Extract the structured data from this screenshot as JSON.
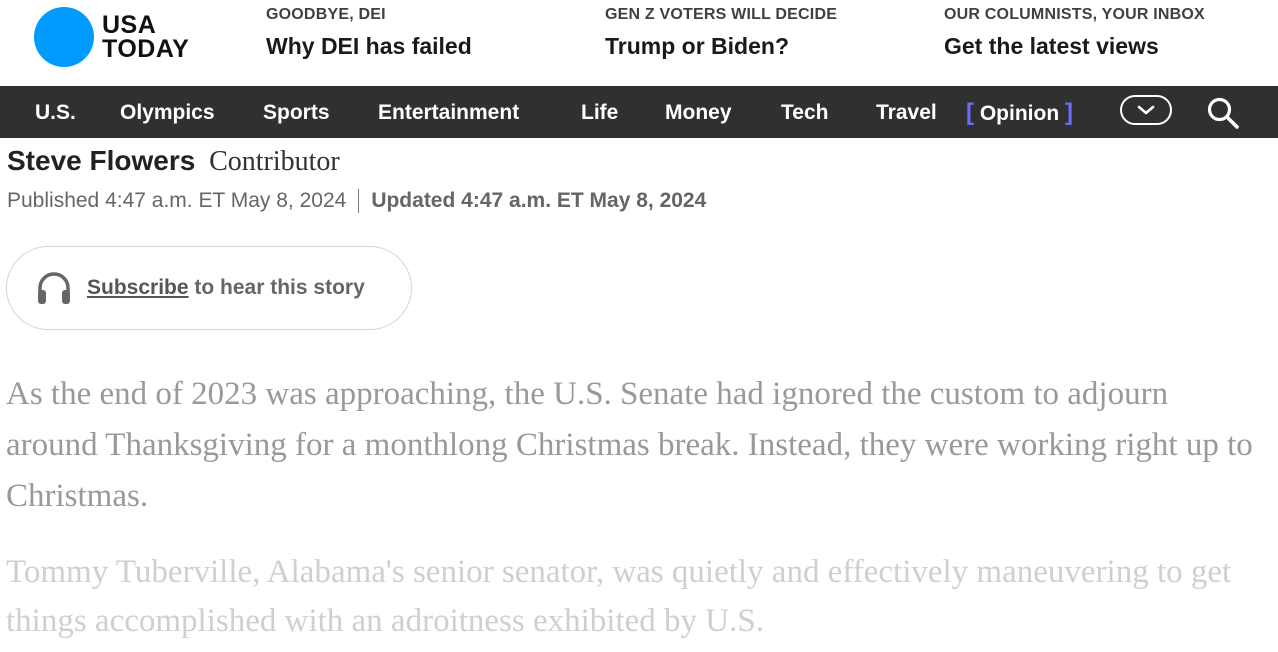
{
  "brand": {
    "line1": "USA",
    "line2": "TODAY",
    "color": "#009bff"
  },
  "promos": [
    {
      "kicker": "GOODBYE, DEI",
      "headline": "Why DEI has failed"
    },
    {
      "kicker": "GEN Z VOTERS WILL DECIDE",
      "headline": "Trump or Biden?"
    },
    {
      "kicker": "OUR COLUMNISTS, YOUR INBOX",
      "headline": "Get the latest views"
    }
  ],
  "nav": {
    "items": [
      "U.S.",
      "Olympics",
      "Sports",
      "Entertainment",
      "Life",
      "Money",
      "Tech",
      "Travel"
    ],
    "active": "Opinion",
    "bracket_open": "[",
    "bracket_close": "]",
    "bracket_color": "#6b6bff",
    "more_icon": "chevron-down-icon",
    "search_icon": "search-icon"
  },
  "article": {
    "author_name": "Steve Flowers",
    "author_role": "Contributor",
    "published": "Published 4:47 a.m. ET May 8, 2024",
    "updated": "Updated 4:47 a.m. ET May 8, 2024",
    "subscribe_link": "Subscribe",
    "subscribe_rest": "to hear this story",
    "headphones_icon": "headphones-icon",
    "paragraphs": [
      "As the end of 2023 was approaching, the U.S. Senate had ignored the custom to adjourn around Thanksgiving for a monthlong Christmas break. Instead, they were working right up to Christmas.",
      "Tommy Tuberville, Alabama's senior senator, was quietly and effectively maneuvering to get things accomplished with an adroitness exhibited by U.S."
    ]
  }
}
